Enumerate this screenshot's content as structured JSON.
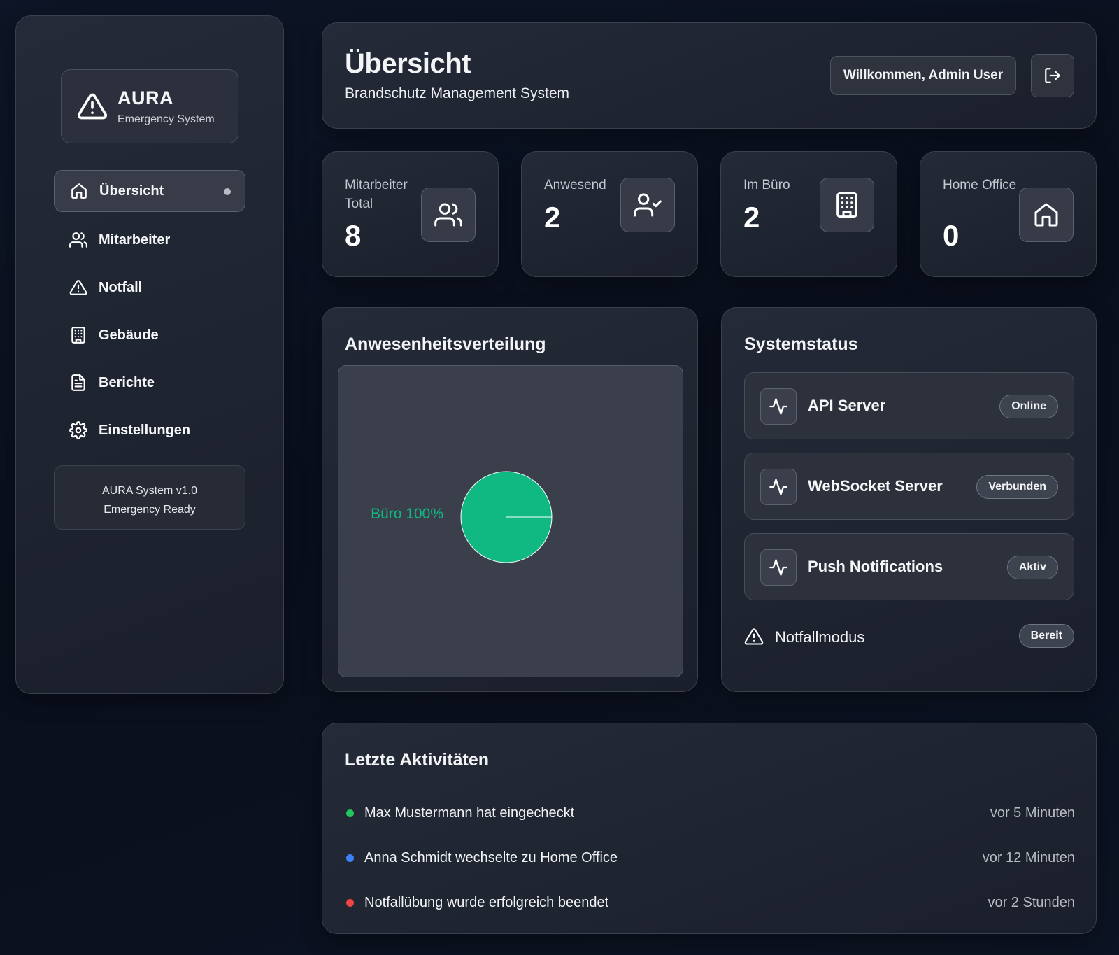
{
  "sidebar": {
    "brand_title": "AURA",
    "brand_subtitle": "Emergency System",
    "brand_icon": "alert-triangle-icon",
    "items": [
      {
        "label": "Übersicht",
        "icon": "home-icon",
        "active": true
      },
      {
        "label": "Mitarbeiter",
        "icon": "users-icon",
        "active": false
      },
      {
        "label": "Notfall",
        "icon": "alert-triangle-icon",
        "active": false
      },
      {
        "label": "Gebäude",
        "icon": "building-icon",
        "active": false
      },
      {
        "label": "Berichte",
        "icon": "file-text-icon",
        "active": false
      },
      {
        "label": "Einstellungen",
        "icon": "gear-icon",
        "active": false
      }
    ],
    "version_line1": "AURA System v1.0",
    "version_line2": "Emergency Ready"
  },
  "header": {
    "title": "Übersicht",
    "subtitle": "Brandschutz Management System",
    "welcome": "Willkommen, Admin User",
    "logout_icon": "log-out-icon"
  },
  "stats": [
    {
      "label": "Mitarbeiter Total",
      "value": "8",
      "icon": "users-icon"
    },
    {
      "label": "Anwesend",
      "value": "2",
      "icon": "user-check-icon"
    },
    {
      "label": "Im Büro",
      "value": "2",
      "icon": "building-icon"
    },
    {
      "label": "Home Office",
      "value": "0",
      "icon": "home-icon"
    }
  ],
  "chart": {
    "title": "Anwesenheitsverteilung",
    "slice_label": "Büro 100%"
  },
  "chart_data": {
    "type": "pie",
    "title": "Anwesenheitsverteilung",
    "slices": [
      {
        "label": "Büro",
        "value": 100,
        "color": "#10b981"
      }
    ]
  },
  "status": {
    "title": "Systemstatus",
    "services": [
      {
        "name": "API Server",
        "badge": "Online",
        "icon": "activity-icon"
      },
      {
        "name": "WebSocket Server",
        "badge": "Verbunden",
        "icon": "activity-icon"
      },
      {
        "name": "Push Notifications",
        "badge": "Aktiv",
        "icon": "activity-icon"
      }
    ],
    "emergency_label": "Notfallmodus",
    "emergency_badge": "Bereit"
  },
  "activities": {
    "title": "Letzte Aktivitäten",
    "items": [
      {
        "text": "Max Mustermann hat eingecheckt",
        "time": "vor 5 Minuten",
        "color": "#22c55e"
      },
      {
        "text": "Anna Schmidt wechselte zu Home Office",
        "time": "vor 12 Minuten",
        "color": "#3b82f6"
      },
      {
        "text": "Notfallübung wurde erfolgreich beendet",
        "time": "vor 2 Stunden",
        "color": "#ef4444"
      }
    ]
  }
}
